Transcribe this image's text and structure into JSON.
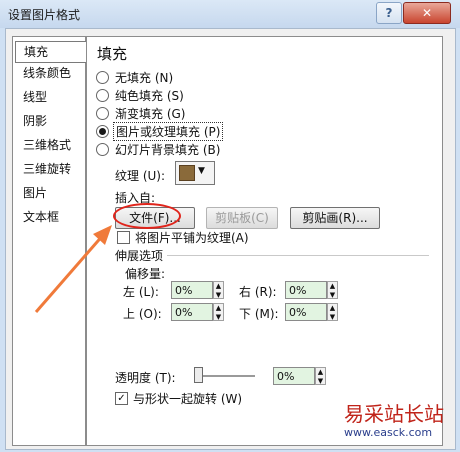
{
  "window": {
    "title": "设置图片格式",
    "help_button": "?",
    "close_button": "✕"
  },
  "sidebar": {
    "items": [
      {
        "label": "填充"
      },
      {
        "label": "线条颜色"
      },
      {
        "label": "线型"
      },
      {
        "label": "阴影"
      },
      {
        "label": "三维格式"
      },
      {
        "label": "三维旋转"
      },
      {
        "label": "图片"
      },
      {
        "label": "文本框"
      }
    ]
  },
  "fill": {
    "heading": "填充",
    "options": [
      {
        "label": "无填充 (N)",
        "selected": false
      },
      {
        "label": "纯色填充 (S)",
        "selected": false
      },
      {
        "label": "渐变填充 (G)",
        "selected": false
      },
      {
        "label": "图片或纹理填充 (P)",
        "selected": true
      },
      {
        "label": "幻灯片背景填充 (B)",
        "selected": false
      }
    ],
    "texture_label": "纹理 (U):",
    "insert_from_label": "插入自:",
    "file_button": "文件(F)...",
    "clipboard_button": "剪贴板(C)",
    "clipart_button": "剪贴画(R)...",
    "tile_checkbox": "将图片平铺为纹理(A)",
    "stretch_options": "伸展选项",
    "offsets_label": "偏移量:",
    "left_label": "左 (L):",
    "left_value": "0%",
    "right_label": "右 (R):",
    "right_value": "0%",
    "top_label": "上 (O):",
    "top_value": "0%",
    "bottom_label": "下 (M):",
    "bottom_value": "0%",
    "transparency_label": "透明度 (T):",
    "transparency_value": "0%",
    "rotate_with_shape": "与形状一起旋转 (W)"
  },
  "watermark": {
    "text": "易采站长站",
    "url": "www.easck.com"
  },
  "colors": {
    "highlight_circle": "#e0241b",
    "arrow": "#f07a3a",
    "spin_bg": "#e2f4e1"
  }
}
